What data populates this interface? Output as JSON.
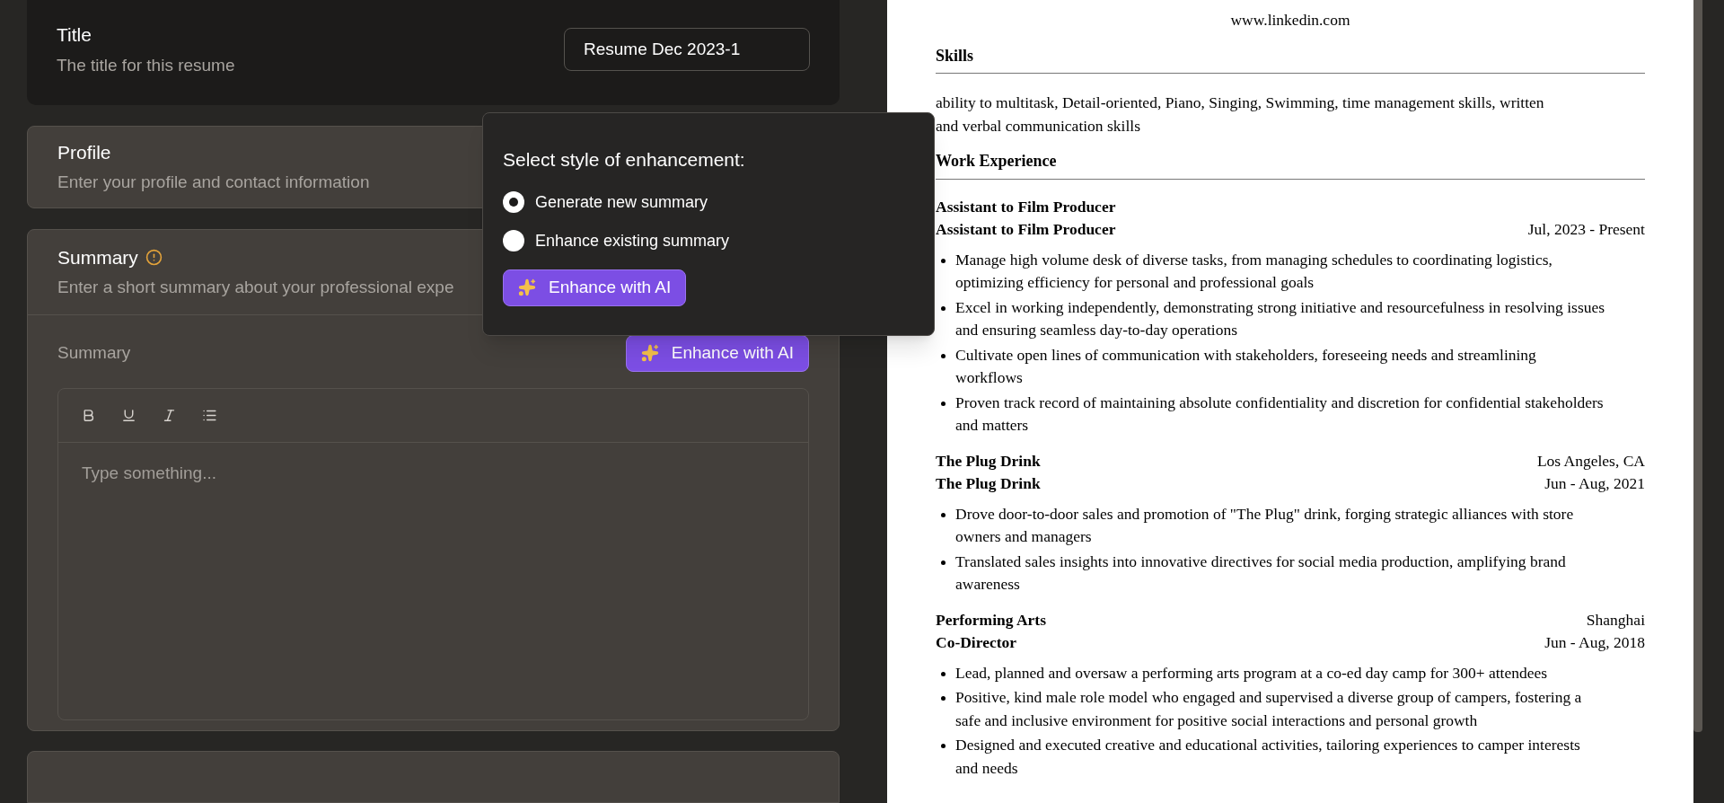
{
  "title_card": {
    "title": "Title",
    "description": "The title for this resume",
    "value": "Resume Dec 2023-1"
  },
  "profile_card": {
    "title": "Profile",
    "description": "Enter your profile and contact information"
  },
  "summary_card": {
    "title": "Summary",
    "description": "Enter a short summary about your professional expe",
    "field_label": "Summary",
    "button": "Enhance with AI",
    "placeholder": "Type something..."
  },
  "popover": {
    "heading": "Select style of enhancement:",
    "options": [
      {
        "label": "Generate new summary",
        "selected": true
      },
      {
        "label": "Enhance existing summary",
        "selected": false
      }
    ],
    "button": "Enhance with AI"
  },
  "resume": {
    "contact_line": "www.linkedin.com",
    "sections": [
      {
        "heading": "Skills",
        "kind": "text",
        "text": "ability to multitask,  Detail-oriented,  Piano,  Singing,  Swimming,  time management skills,  written and verbal communication skills"
      },
      {
        "heading": "Work Experience",
        "kind": "entries",
        "entries": [
          {
            "title": "Assistant to Film Producer",
            "subtitle": "Assistant to Film Producer",
            "date": "Jul, 2023 - Present",
            "bullets": [
              "Manage high volume desk of diverse tasks, from managing schedules to coordinating logistics, optimizing efficiency for personal and professional goals",
              "Excel in working independently, demonstrating strong initiative and resourcefulness in resolving issues and ensuring seamless day-to-day operations",
              "Cultivate open lines of communication with stakeholders, foreseeing needs and streamlining workflows",
              "Proven track record of maintaining absolute confidentiality and discretion for confidential stakeholders and matters"
            ]
          },
          {
            "title": "The Plug Drink",
            "location": "Los Angeles, CA",
            "subtitle": "The Plug Drink",
            "date": "Jun - Aug, 2021",
            "bullets": [
              "Drove door-to-door sales and promotion of \"The Plug\" drink, forging strategic alliances with store owners and managers",
              "Translated sales insights into innovative directives for social media production, amplifying brand awareness"
            ]
          },
          {
            "title": "Performing Arts",
            "location": "Shanghai",
            "subtitle": "Co-Director",
            "date": "Jun - Aug, 2018",
            "bullets": [
              "Lead, planned and oversaw a performing arts program at a co-ed day camp for 300+ attendees",
              "Positive, kind male role model who engaged and supervised a diverse group of campers, fostering a safe and inclusive environment for positive social interactions and personal growth",
              "Designed and executed creative and educational activities, tailoring experiences to camper interests and needs"
            ]
          }
        ]
      }
    ]
  }
}
